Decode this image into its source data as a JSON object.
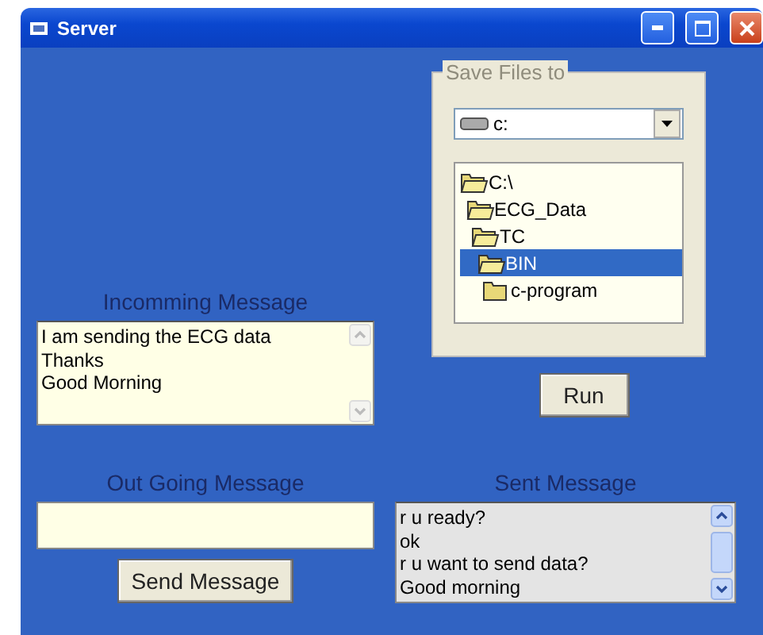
{
  "window": {
    "title": "Server"
  },
  "save_frame": {
    "label": "Save Files to",
    "drive": "c:",
    "tree": [
      {
        "label": "C:\\",
        "expanded": true,
        "selected": false,
        "children": [
          {
            "label": "ECG_Data",
            "expanded": true,
            "selected": false,
            "children": [
              {
                "label": "TC",
                "expanded": true,
                "selected": false,
                "children": [
                  {
                    "label": "BIN",
                    "expanded": true,
                    "selected": true,
                    "children": [
                      {
                        "label": "c-program",
                        "expanded": false,
                        "selected": false
                      }
                    ]
                  }
                ]
              }
            ]
          }
        ]
      }
    ]
  },
  "run_button": "Run",
  "incoming": {
    "label": "Incomming Message",
    "lines": [
      "I am sending the ECG data",
      "Thanks",
      "Good Morning"
    ]
  },
  "outgoing": {
    "label": "Out Going Message",
    "button": "Send Message"
  },
  "sent": {
    "label": "Sent Message",
    "lines": [
      "r u ready?",
      "ok",
      "r u want to send data?",
      "Good morning"
    ]
  }
}
